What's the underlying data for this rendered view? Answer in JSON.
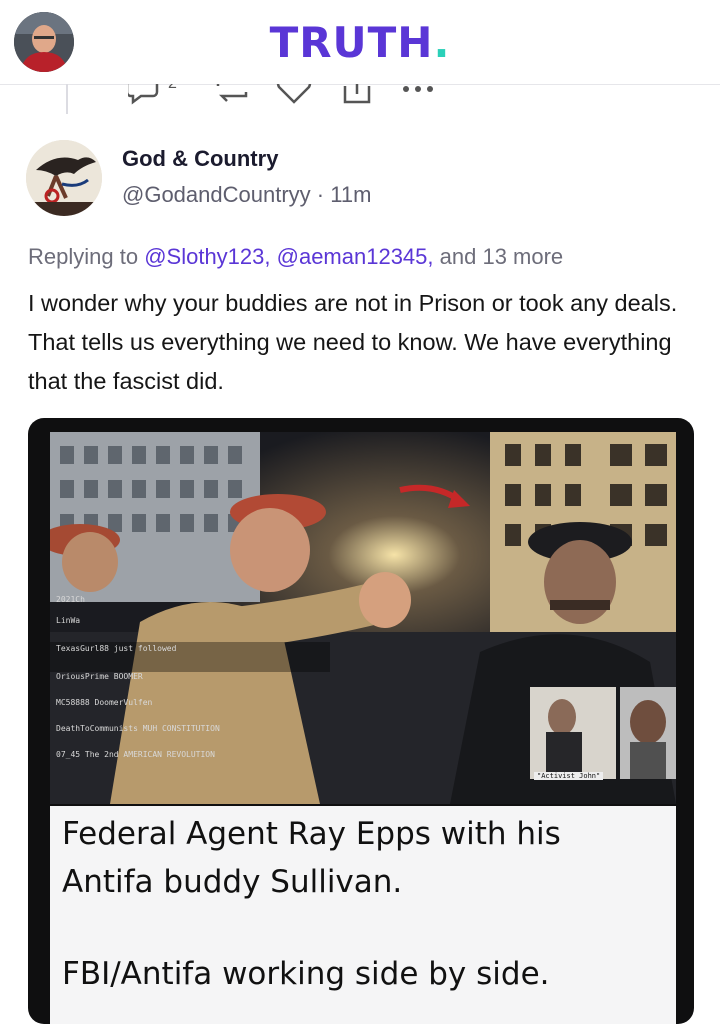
{
  "header": {
    "logo_text": "TRUTH",
    "logo_dot": ".",
    "brand_color": "#5a36d6",
    "accent_color": "#2bd0b8"
  },
  "previous_post": {
    "reply_count": "2"
  },
  "post": {
    "author_name": "God & Country",
    "handle": "@GodandCountryy",
    "separator": "·",
    "time": "11m",
    "replying_prefix": "Replying to",
    "mention_1": "@Slothy123,",
    "mention_2": "@aeman12345,",
    "replying_suffix": "and 13 more",
    "text": "I wonder why your buddies are not in Prison or took any deals. That tells us everything we need to know. We have everything that the fascist did."
  },
  "media": {
    "overlay_lines": [
      "2021Ch",
      "LinWa",
      "TexasGurl88  just followed",
      "OriousPrime  BOOMER",
      "MC58888  DoomerVulfen",
      "DeathToCommunists  MUH CONSTITUTION",
      "07_45  The 2nd AMERICAN REVOLUTION"
    ],
    "inset_label": "\"Activist John\"",
    "caption_line_1": "Federal Agent Ray Epps with his",
    "caption_line_2": "Antifa buddy Sullivan.",
    "caption_line_3": "FBI/Antifa working side by side."
  },
  "icons": [
    "user-avatar-icon",
    "reply-icon",
    "retruth-icon",
    "like-icon",
    "share-icon",
    "more-icon"
  ]
}
